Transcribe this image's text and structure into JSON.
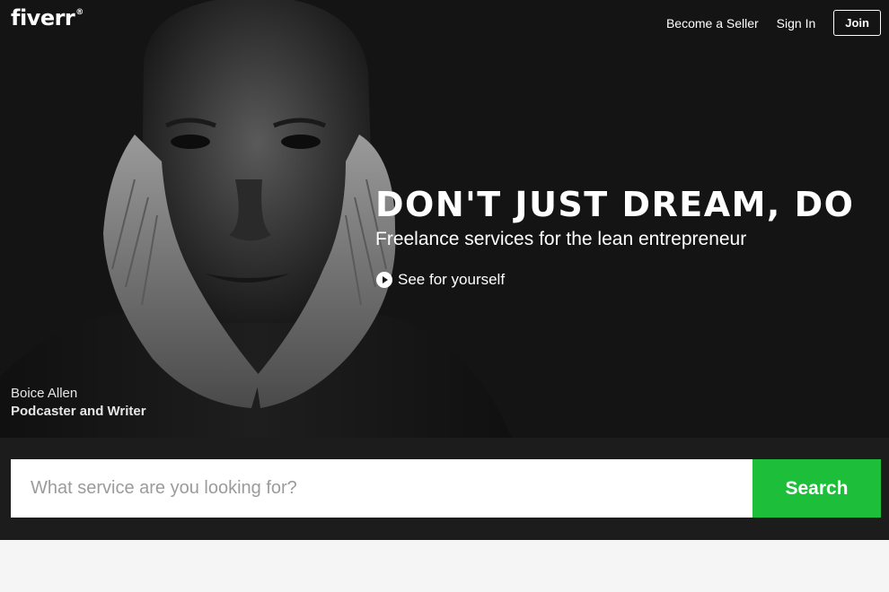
{
  "brand": {
    "logo_text": "fiverr",
    "registered_mark": "®"
  },
  "nav": {
    "become_seller_label": "Become a Seller",
    "sign_in_label": "Sign In",
    "join_label": "Join"
  },
  "hero": {
    "headline": "DON'T JUST DREAM, DO",
    "subheadline": "Freelance services for the lean entrepreneur",
    "video_link_label": "See for yourself",
    "credit_name": "Boice Allen",
    "credit_role": "Podcaster and Writer"
  },
  "search": {
    "placeholder": "What service are you looking for?",
    "value": "",
    "button_label": "Search"
  },
  "colors": {
    "accent": "#1dbf3a",
    "hero_bg": "#141414",
    "search_band_bg": "#1c1c1c",
    "page_bg": "#f5f5f5"
  }
}
